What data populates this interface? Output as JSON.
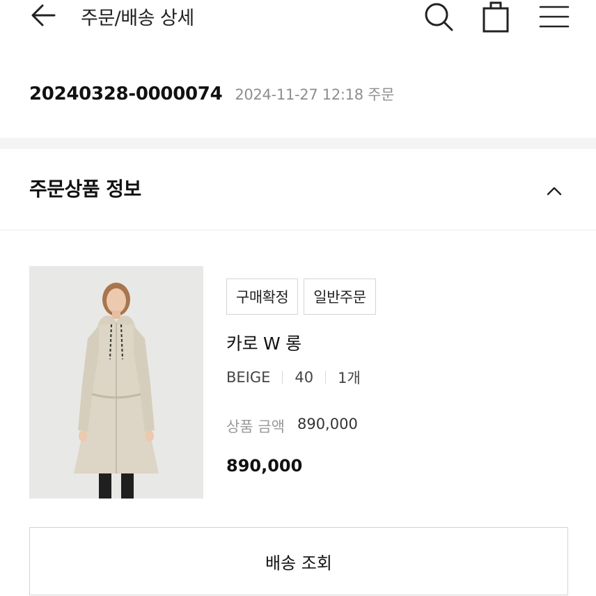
{
  "header": {
    "title": "주문/배송 상세",
    "back_icon": "arrow-left-icon",
    "search_icon": "search-icon",
    "cart_icon": "shopping-bag-icon",
    "menu_icon": "hamburger-menu-icon"
  },
  "order": {
    "number": "20240328-0000074",
    "date": "2024-11-27 12:18 주문"
  },
  "section": {
    "title": "주문상품 정보",
    "toggle_icon": "chevron-up-icon"
  },
  "product": {
    "badges": [
      "구매확정",
      "일반주문"
    ],
    "name": "카로 W 롱",
    "options": [
      "BEIGE",
      "40",
      "1개"
    ],
    "price_label": "상품 금액",
    "price_value": "890,000",
    "total": "890,000"
  },
  "actions": {
    "track_label": "배송 조회"
  },
  "colors": {
    "text": "#111111",
    "muted": "#8e8e8e",
    "border": "#d4d4d4",
    "band": "#f4f4f4",
    "coat": "#ddd5c5"
  }
}
